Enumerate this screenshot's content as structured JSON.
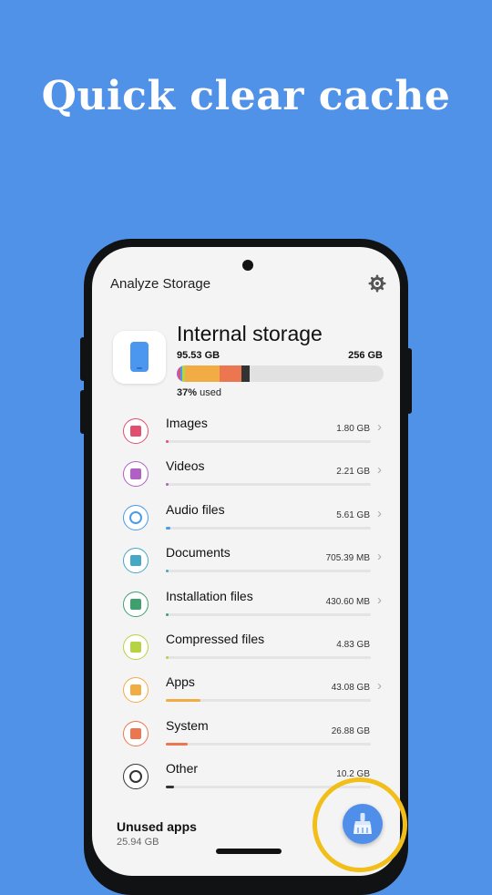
{
  "headline": "Quick clear cache",
  "app": {
    "title": "Analyze Storage"
  },
  "storage": {
    "title": "Internal storage",
    "used": "95.53 GB",
    "total": "256 GB",
    "percent": "37%",
    "percent_suffix": " used",
    "fraction_used": 0.37,
    "segments": [
      {
        "color": "#b05fc4",
        "fraction": 0.008
      },
      {
        "color": "#e2506f",
        "fraction": 0.008
      },
      {
        "color": "#4a9be8",
        "fraction": 0.012
      },
      {
        "color": "#b5d342",
        "fraction": 0.012
      },
      {
        "color": "#f2ac44",
        "fraction": 0.168
      },
      {
        "color": "#ec7650",
        "fraction": 0.105
      },
      {
        "color": "#333333",
        "fraction": 0.04
      }
    ]
  },
  "categories": [
    {
      "name": "Images",
      "size": "1.80 GB",
      "color": "#e2506f",
      "fraction": 0.01,
      "chevron": true,
      "icon": "image-icon"
    },
    {
      "name": "Videos",
      "size": "2.21 GB",
      "color": "#b05fc4",
      "fraction": 0.01,
      "chevron": true,
      "icon": "video-icon"
    },
    {
      "name": "Audio files",
      "size": "5.61 GB",
      "color": "#4a9be8",
      "fraction": 0.022,
      "chevron": true,
      "icon": "headphones-icon"
    },
    {
      "name": "Documents",
      "size": "705.39 MB",
      "color": "#45a8c4",
      "fraction": 0.005,
      "chevron": true,
      "icon": "document-icon"
    },
    {
      "name": "Installation files",
      "size": "430.60 MB",
      "color": "#3fa06f",
      "fraction": 0.004,
      "chevron": true,
      "icon": "android-icon"
    },
    {
      "name": "Compressed files",
      "size": "4.83 GB",
      "color": "#b5d342",
      "fraction": 0.006,
      "chevron": false,
      "icon": "archive-icon"
    },
    {
      "name": "Apps",
      "size": "43.08 GB",
      "color": "#f2ac44",
      "fraction": 0.168,
      "chevron": true,
      "icon": "apps-icon"
    },
    {
      "name": "System",
      "size": "26.88 GB",
      "color": "#ec7650",
      "fraction": 0.105,
      "chevron": false,
      "icon": "system-icon"
    },
    {
      "name": "Other",
      "size": "10.2 GB",
      "color": "#333333",
      "fraction": 0.04,
      "chevron": false,
      "icon": "settings-icon"
    }
  ],
  "unused_apps": {
    "title": "Unused apps",
    "size": "25.94 GB"
  },
  "fab": {
    "icon": "broom-icon"
  },
  "colors": {
    "background": "#5192e9",
    "highlight_ring": "#f2be1a",
    "accent": "#4f8fea"
  }
}
